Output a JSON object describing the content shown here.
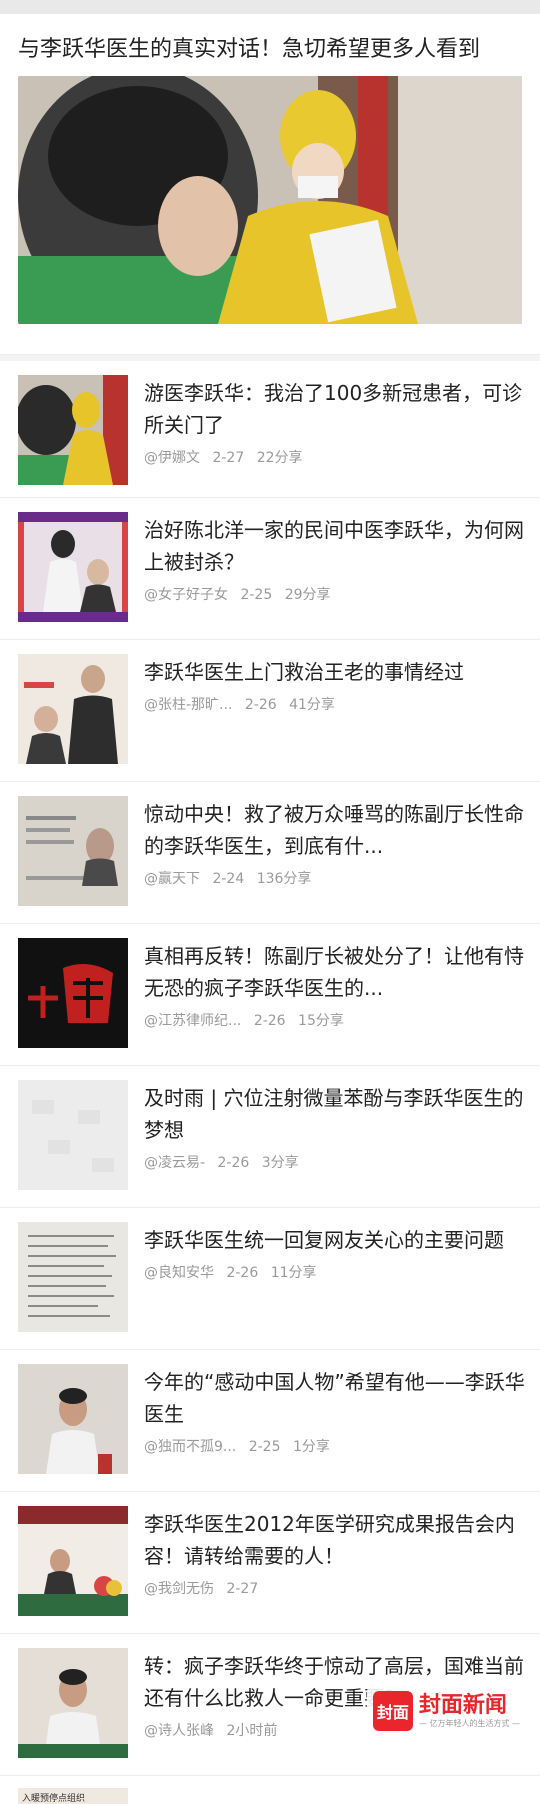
{
  "featured": {
    "title": "与李跃华医生的真实对话！急切希望更多人看到"
  },
  "items": [
    {
      "title": "游医李跃华：我治了100多新冠患者，可诊所关门了",
      "source": "@伊娜文",
      "date": "2-27",
      "shares": "22分享"
    },
    {
      "title": "治好陈北洋一家的民间中医李跃华，为何网上被封杀？",
      "source": "@女子好子女",
      "date": "2-25",
      "shares": "29分享"
    },
    {
      "title": "李跃华医生上门救治王老的事情经过",
      "source": "@张柱-那旷...",
      "date": "2-26",
      "shares": "41分享"
    },
    {
      "title": "惊动中央！救了被万众唾骂的陈副厅长性命的李跃华医生，到底有什...",
      "source": "@赢天下",
      "date": "2-24",
      "shares": "136分享"
    },
    {
      "title": "真相再反转！陈副厅长被处分了！让他有恃无恐的疯子李跃华医生的...",
      "source": "@江苏律师纪...",
      "date": "2-26",
      "shares": "15分享"
    },
    {
      "title": "及时雨 | 穴位注射微量苯酚与李跃华医生的梦想",
      "source": "@凌云易-",
      "date": "2-26",
      "shares": "3分享"
    },
    {
      "title": "李跃华医生统一回复网友关心的主要问题",
      "source": "@良知安华",
      "date": "2-26",
      "shares": "11分享"
    },
    {
      "title": "今年的“感动中国人物”希望有他——李跃华医生",
      "source": "@独而不孤9...",
      "date": "2-25",
      "shares": "1分享"
    },
    {
      "title": "李跃华医生2012年医学研究成果报告会内容！请转给需要的人！",
      "source": "@我剑无伤",
      "date": "2-27",
      "shares": ""
    },
    {
      "title": "转：疯子李跃华终于惊动了高层，国难当前还有什么比救人一命更重要？",
      "source": "@诗人张峰",
      "date": "2小时前",
      "shares": ""
    }
  ],
  "watermark": {
    "logo": "封面",
    "main": "封面新闻",
    "sub": "— 亿万年轻人的生活方式 —"
  },
  "bottom_partial_thumb_text": "入暖预停点组织"
}
